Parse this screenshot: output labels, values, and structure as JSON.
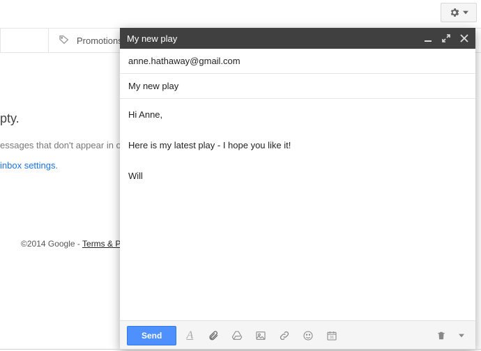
{
  "gear_dropdown": {
    "label": ""
  },
  "tabs": {
    "promotions": "Promotions"
  },
  "background": {
    "empty_title_fragment": "pty.",
    "line_fragment": "essages that don't appear in ot",
    "link_text": "inbox settings",
    "link_suffix": "."
  },
  "footer": {
    "copyright": "©2014 Google - ",
    "terms_fragment": "Terms & Pri"
  },
  "compose": {
    "title": "My new play",
    "to": "anne.hathaway@gmail.com",
    "subject": "My new play",
    "body": "Hi Anne,\n\nHere is my latest play - I hope you like it!\n\nWill",
    "send_label": "Send"
  }
}
